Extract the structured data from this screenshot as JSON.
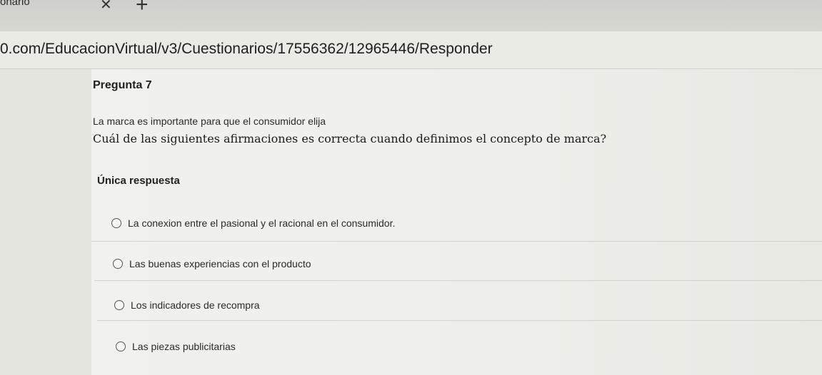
{
  "browser": {
    "tab_title": "onario",
    "close_glyph": "✕",
    "new_tab_glyph": "+",
    "url": "0.com/EducacionVirtual/v3/Cuestionarios/17556362/12965446/Responder"
  },
  "question": {
    "number_label": "Pregunta 7",
    "intro": "La marca es importante para que el consumidor elija",
    "text": "Cuál de las siguientes afirmaciones es correcta cuando definimos el concepto de marca?",
    "answer_type": "Única respuesta",
    "options": [
      {
        "label": "La conexion entre el pasional y el racional en el consumidor.",
        "selected": false
      },
      {
        "label": "Las buenas experiencias con el producto",
        "selected": false
      },
      {
        "label": "Los indicadores de recompra",
        "selected": false
      },
      {
        "label": "Las piezas publicitarias",
        "selected": false
      }
    ]
  },
  "icons": {
    "radio": "radio-unchecked-icon",
    "close": "close-icon",
    "new_tab": "plus-icon"
  }
}
